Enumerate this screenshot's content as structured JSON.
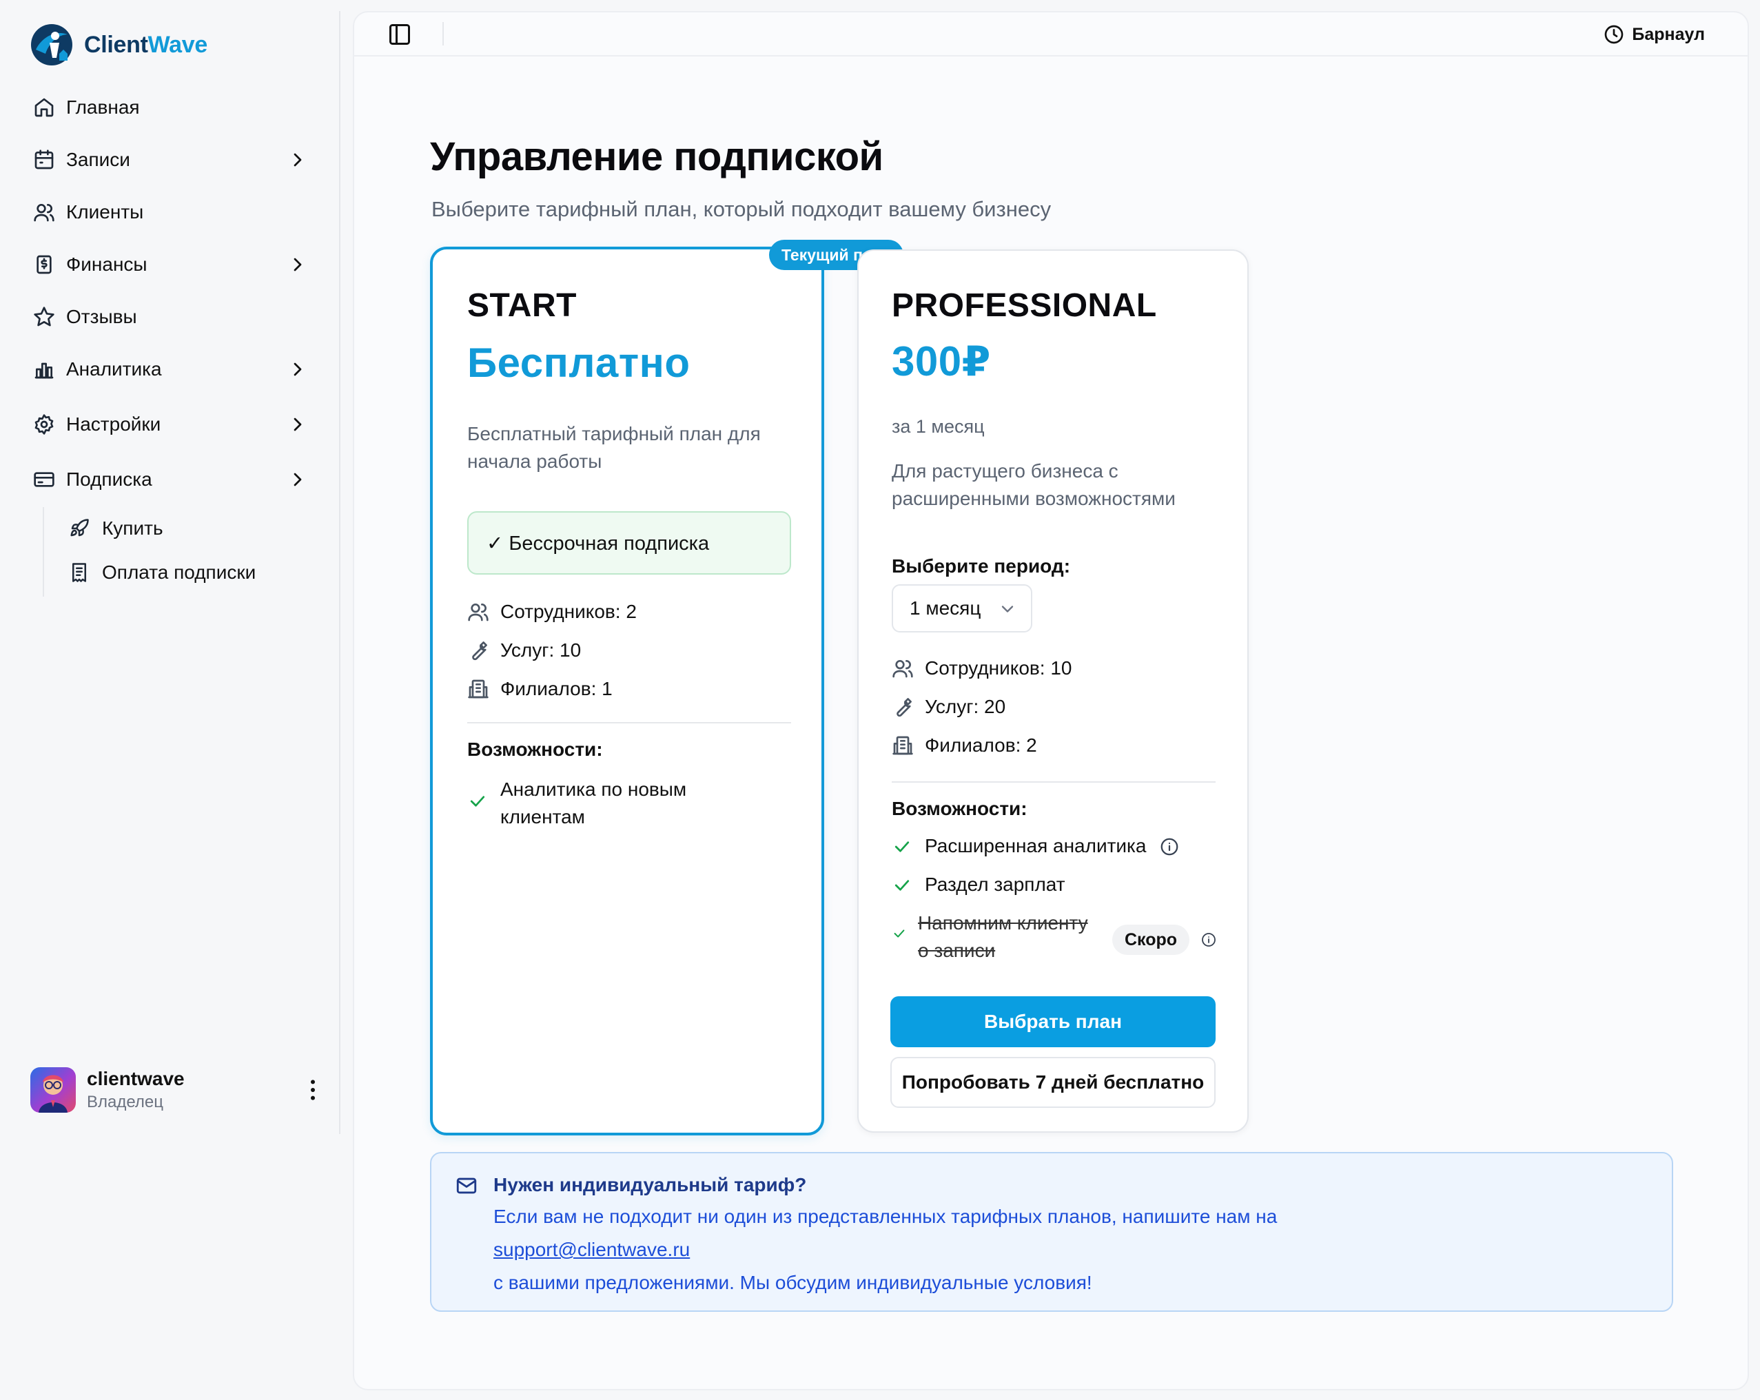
{
  "app": {
    "brand_part1": "Client",
    "brand_part2": "Wave",
    "accent_color": "#119ad8"
  },
  "sidebar": {
    "items": [
      {
        "label": "Главная",
        "icon": "home-icon",
        "has_submenu": false
      },
      {
        "label": "Записи",
        "icon": "calendar-icon",
        "has_submenu": true
      },
      {
        "label": "Клиенты",
        "icon": "users-icon",
        "has_submenu": false
      },
      {
        "label": "Финансы",
        "icon": "money-icon",
        "has_submenu": true
      },
      {
        "label": "Отзывы",
        "icon": "star-icon",
        "has_submenu": false
      },
      {
        "label": "Аналитика",
        "icon": "chart-icon",
        "has_submenu": true
      },
      {
        "label": "Настройки",
        "icon": "gear-icon",
        "has_submenu": true
      },
      {
        "label": "Подписка",
        "icon": "card-icon",
        "has_submenu": true
      }
    ],
    "subitems": [
      {
        "label": "Купить",
        "icon": "rocket-icon"
      },
      {
        "label": "Оплата подписки",
        "icon": "receipt-icon"
      }
    ],
    "user": {
      "name": "clientwave",
      "role": "Владелец"
    }
  },
  "topbar": {
    "city": "Барнаул"
  },
  "page": {
    "title": "Управление подпиской",
    "subtitle": "Выберите тарифный план, который подходит вашему бизнесу"
  },
  "plans": {
    "start": {
      "badge": "Текущий план",
      "name": "START",
      "price": "Бесплатно",
      "desc_line1": "Бесплатный тарифный план для",
      "desc_line2": "начала работы",
      "forever": "✓ Бессрочная подписка",
      "staff": "Сотрудников: 2",
      "services": "Услуг: 10",
      "branches": "Филиалов: 1",
      "features_title": "Возможности:",
      "feature1_line1": "Аналитика по новым",
      "feature1_line2": "клиентам"
    },
    "pro": {
      "name": "PROFESSIONAL",
      "price": "300₽",
      "period": "за 1 месяц",
      "desc_line1": "Для растущего бизнеса с",
      "desc_line2": "расширенными возможностями",
      "period_label": "Выберите период:",
      "period_value": "1 месяц",
      "staff": "Сотрудников: 10",
      "services": "Услуг: 20",
      "branches": "Филиалов: 2",
      "features_title": "Возможности:",
      "feature1": "Расширенная аналитика",
      "feature2": "Раздел зарплат",
      "feature3_line1": "Напомним клиенту",
      "feature3_line2": "о записи",
      "soon": "Скоро",
      "choose_button": "Выбрать план",
      "trial_button": "Попробовать 7 дней бесплатно"
    }
  },
  "notice": {
    "title": "Нужен индивидуальный тариф?",
    "line1": "Если вам не подходит ни один из представленных тарифных планов, напишите нам на",
    "email": "support@clientwave.ru",
    "line3": "с вашими предложениями. Мы обсудим индивидуальные условия!"
  }
}
